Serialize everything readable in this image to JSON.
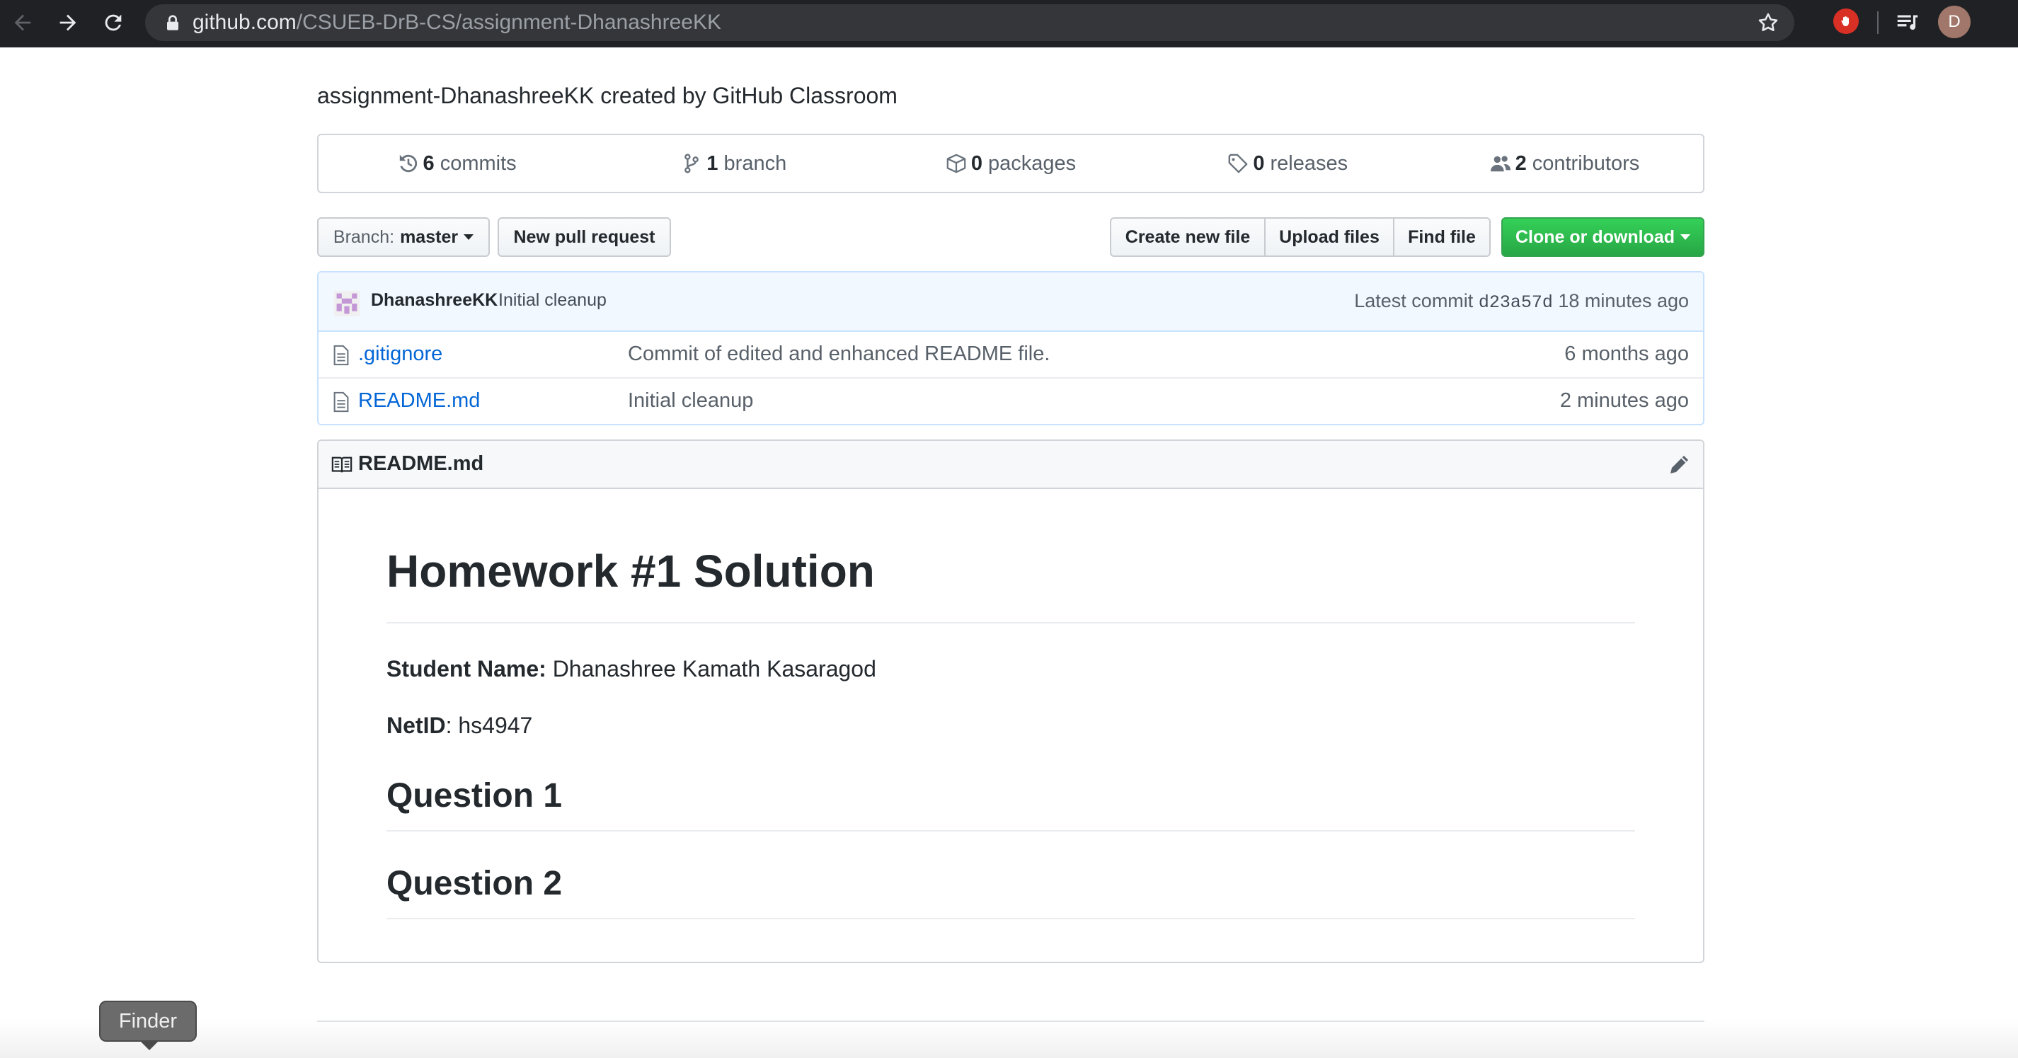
{
  "browser": {
    "url_host": "github.com",
    "url_path": "/CSUEB-DrB-CS/assignment-DhanashreeKK",
    "profile_initial": "D",
    "icons": {
      "back": "back-arrow-icon",
      "forward": "forward-arrow-icon",
      "reload": "reload-icon",
      "lock": "lock-icon",
      "bookmark": "star-icon",
      "extension": "stop-hand-icon",
      "media": "media-queue-icon"
    }
  },
  "repo": {
    "description": "assignment-DhanashreeKK created by GitHub Classroom"
  },
  "numbers_summary": [
    {
      "count": "6",
      "label": "commits",
      "icon": "history-icon"
    },
    {
      "count": "1",
      "label": "branch",
      "icon": "git-branch-icon"
    },
    {
      "count": "0",
      "label": "packages",
      "icon": "package-icon"
    },
    {
      "count": "0",
      "label": "releases",
      "icon": "tag-icon"
    },
    {
      "count": "2",
      "label": "contributors",
      "icon": "people-icon"
    }
  ],
  "toolbar": {
    "branch_prefix": "Branch:",
    "branch_name": "master",
    "new_pull_request": "New pull request",
    "create_new_file": "Create new file",
    "upload_files": "Upload files",
    "find_file": "Find file",
    "clone_or_download": "Clone or download"
  },
  "latest_commit": {
    "author": "DhanashreeKK",
    "message": "Initial cleanup",
    "prefix": "Latest commit",
    "sha": "d23a57d",
    "age": "18 minutes ago"
  },
  "files": [
    {
      "name": ".gitignore",
      "message": "Commit of edited and enhanced README file.",
      "age": "6 months ago"
    },
    {
      "name": "README.md",
      "message": "Initial cleanup",
      "age": "2 minutes ago"
    }
  ],
  "readme": {
    "header": "README.md",
    "h1": "Homework #1 Solution",
    "student_label": "Student Name:",
    "student_value": " Dhanashree Kamath Kasaragod",
    "netid_label": "NetID",
    "netid_value": ": hs4947",
    "q1": "Question 1",
    "q2": "Question 2"
  },
  "dock_tooltip": "Finder",
  "colors": {
    "link": "#0366d6",
    "clone_button": "#28a745",
    "commit_tease_bg": "#f1f8ff",
    "chrome_bg": "#202124"
  }
}
